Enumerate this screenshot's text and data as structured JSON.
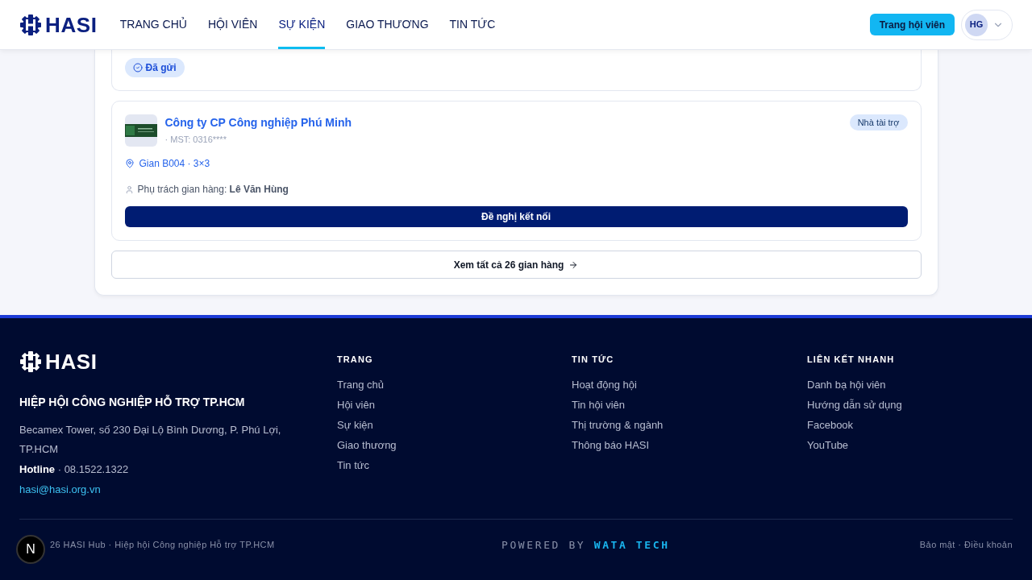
{
  "header": {
    "logo_text": "HASI",
    "nav": [
      {
        "label": "TRANG CHỦ",
        "selected": false
      },
      {
        "label": "HỘI VIÊN",
        "selected": false
      },
      {
        "label": "SỰ KIỆN",
        "selected": true
      },
      {
        "label": "GIAO THƯƠNG",
        "selected": false
      },
      {
        "label": "TIN TỨC",
        "selected": false
      }
    ],
    "member_button": "Trang hội viên",
    "avatar": "HG"
  },
  "booths": [
    {
      "partial": true,
      "status": "Đã gửi"
    },
    {
      "partial": false,
      "company": "Công ty CP Công nghiệp Phú Minh",
      "tax_id": "· MST: 0316****",
      "tag": "Nhà tài trợ",
      "booth": "Gian B004 · 3×3",
      "manager_label": "Phụ trách gian hàng:",
      "manager": "Lê Văn Hùng",
      "action": "Đề nghị kết nối"
    }
  ],
  "view_all": "Xem tất cả 26 gian hàng",
  "footer": {
    "logo_text": "HASI",
    "org": "HIỆP HỘI CÔNG NGHIỆP HỖ TRỢ TP.HCM",
    "address": "Becamex Tower, số 230 Đại Lộ Bình Dương, P. Phú Lợi, TP.HCM",
    "hotline_label": "Hotline",
    "hotline": "· 08.1522.1322",
    "email": "hasi@hasi.org.vn",
    "columns": [
      {
        "title": "TRANG",
        "links": [
          "Trang chủ",
          "Hội viên",
          "Sự kiện",
          "Giao thương",
          "Tin tức"
        ]
      },
      {
        "title": "TIN TỨC",
        "links": [
          "Hoạt động hội",
          "Tin hội viên",
          "Thị trường & ngành",
          "Thông báo HASI"
        ]
      },
      {
        "title": "LIÊN KẾT NHANH",
        "links": [
          "Danh bạ hội viên",
          "Hướng dẫn sử dụng",
          "Facebook",
          "YouTube"
        ]
      }
    ],
    "copyright": "26 HASI Hub · Hiệp hội Công nghiệp Hỗ trợ TP.HCM",
    "powered_label": "POWERED BY",
    "powered_brand": "WATA TECH",
    "legal": "Bảo mật · Điều khoản",
    "dev_badge": "N"
  }
}
